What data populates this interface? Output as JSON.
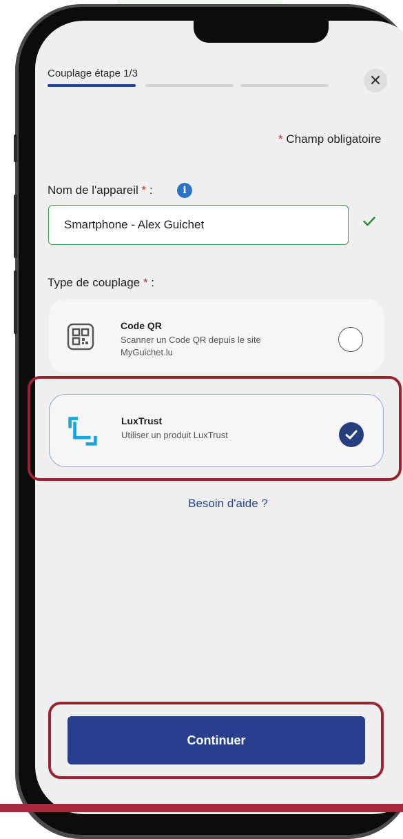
{
  "colors": {
    "accent_blue": "#273f8e",
    "progress_active": "#1f4396",
    "progress_inactive": "#d2d2d2",
    "valid_green": "#3d9a4a",
    "required_red": "#c0272d",
    "highlight_red": "#9c2230",
    "luxtrust_cyan": "#1aa5dc"
  },
  "header": {
    "step_title": "Couplage étape 1/3",
    "progress": {
      "current_step": 1,
      "total_steps": 3
    },
    "close_icon": "close-icon",
    "close_glyph": "✕"
  },
  "required_note": {
    "star": "*",
    "text": " Champ obligatoire"
  },
  "device_name": {
    "label": "Nom de l'appareil",
    "star": "*",
    "suffix": " :",
    "info_icon": "info-icon",
    "info_glyph": "i",
    "value": "Smartphone - Alex Guichet",
    "valid_icon": "checkmark-icon"
  },
  "coupling_type": {
    "label": "Type de couplage",
    "star": "*",
    "suffix": " :",
    "options": [
      {
        "icon": "qr-code-icon",
        "title": "Code QR",
        "description": "Scanner un Code QR depuis le site MyGuichet.lu",
        "selected": false
      },
      {
        "icon": "luxtrust-icon",
        "title": "LuxTrust",
        "description": "Utiliser un produit LuxTrust",
        "selected": true
      }
    ]
  },
  "help_link": "Besoin d'aide ?",
  "continue_button": "Continuer"
}
